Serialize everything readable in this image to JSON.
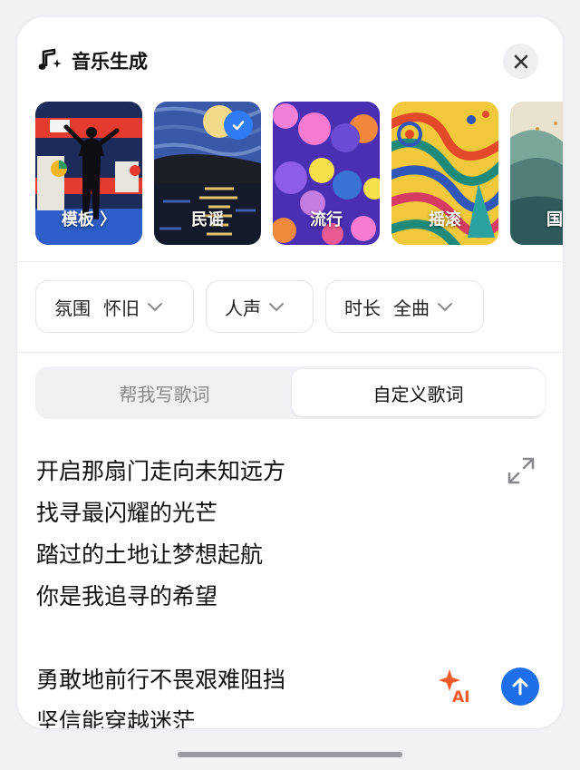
{
  "header": {
    "title": "音乐生成",
    "icon": "music-note-sparkle-icon",
    "close_icon": "close-icon"
  },
  "styles": [
    {
      "label": "模板 〉",
      "selected": false
    },
    {
      "label": "民谣",
      "selected": true
    },
    {
      "label": "流行",
      "selected": false
    },
    {
      "label": "摇滚",
      "selected": false
    },
    {
      "label": "国",
      "selected": false
    }
  ],
  "filters": [
    {
      "label": "氛围",
      "value": "怀旧"
    },
    {
      "label": "人声",
      "value": ""
    },
    {
      "label": "时长",
      "value": "全曲"
    }
  ],
  "tabs": [
    {
      "label": "帮我写歌词",
      "active": false
    },
    {
      "label": "自定义歌词",
      "active": true
    }
  ],
  "lyrics": {
    "lines": [
      "开启那扇门走向未知远方",
      "找寻最闪耀的光芒",
      "踏过的土地让梦想起航",
      "你是我追寻的希望",
      "",
      "勇敢地前行不畏艰难阻挡",
      "坚信能穿越迷茫"
    ]
  },
  "actions": {
    "ai_label": "AI",
    "expand_icon": "expand-icon",
    "send_icon": "arrow-up-icon"
  },
  "colors": {
    "accent": "#1e6fe9",
    "check": "#2f7cf6",
    "ai_orange": "#f25a2a"
  }
}
